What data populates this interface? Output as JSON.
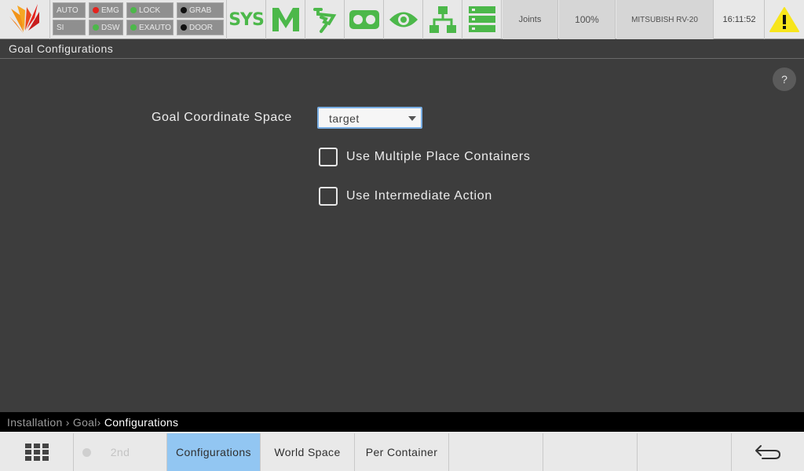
{
  "topbar": {
    "status": {
      "auto": "AUTO",
      "si": "SI",
      "emg": "EMG",
      "dsw": "DSW",
      "lock": "LOCK",
      "exauto": "EXAUTO",
      "grab": "GRAB",
      "door": "DOOR"
    },
    "sys_label": "SYS",
    "mode": "Joints",
    "speed": "100%",
    "robot": "MITSUBISH RV-20",
    "time": "16:11:52",
    "colors": {
      "accent_green": "#4cb84a",
      "warning": "#f7e51b",
      "red": "#e4231e"
    }
  },
  "title": "Goal Configurations",
  "help_label": "?",
  "form": {
    "coord_label": "Goal Coordinate Space",
    "coord_value": "target",
    "multi_place_label": "Use Multiple Place Containers",
    "multi_place_checked": false,
    "intermediate_label": "Use Intermediate Action",
    "intermediate_checked": false
  },
  "breadcrumb": {
    "part1": "Installation",
    "sep1": " › ",
    "part2": "Goal",
    "sep2": "› ",
    "current": "Configurations"
  },
  "bottombar": {
    "second_label": "2nd",
    "tabs": [
      "Configurations",
      "World Space",
      "Per Container"
    ]
  }
}
